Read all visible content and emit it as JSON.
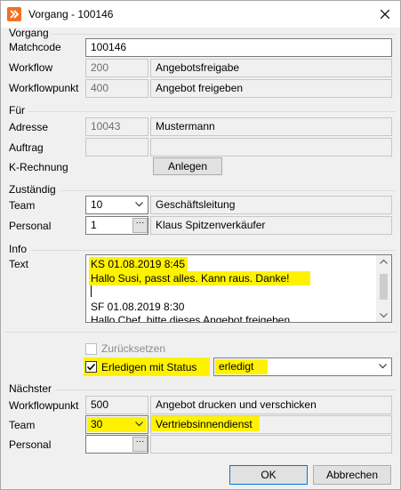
{
  "window": {
    "title": "Vorgang - 100146",
    "icon": "app-icon",
    "close_icon": "close-icon"
  },
  "vorgang": {
    "group_label": "Vorgang",
    "matchcode": {
      "label": "Matchcode",
      "value": "100146"
    },
    "workflow": {
      "label": "Workflow",
      "code": "200",
      "name": "Angebotsfreigabe"
    },
    "workflowpunkt": {
      "label": "Workflowpunkt",
      "code": "400",
      "name": "Angebot freigeben"
    }
  },
  "fuer": {
    "group_label": "Für",
    "adresse": {
      "label": "Adresse",
      "code": "10043",
      "name": "Mustermann"
    },
    "auftrag": {
      "label": "Auftrag",
      "code": "",
      "name": ""
    },
    "k_rechnung": {
      "label": "K-Rechnung",
      "button": "Anlegen"
    }
  },
  "zustaendig": {
    "group_label": "Zuständig",
    "team": {
      "label": "Team",
      "code": "10",
      "name": "Geschäftsleitung"
    },
    "personal": {
      "label": "Personal",
      "code": "1",
      "button": "···",
      "name": "Klaus Spitzenverkäufer"
    }
  },
  "info": {
    "group_label": "Info",
    "text_label": "Text",
    "lines": [
      "KS 01.08.2019 8:45",
      "Hallo Susi, passt alles. Kann raus. Danke!",
      "",
      "SF 01.08.2019 8:30",
      "Hallo Chef, bitte dieses Angebot freigeben."
    ]
  },
  "status": {
    "reset_label": "Zurücksetzen",
    "reset_checked": false,
    "complete_label": "Erledigen mit Status",
    "complete_checked": true,
    "status_value": "erledigt"
  },
  "naechster": {
    "group_label": "Nächster",
    "workflowpunkt": {
      "label": "Workflowpunkt",
      "code": "500",
      "name": "Angebot drucken und verschicken"
    },
    "team": {
      "label": "Team",
      "code": "30",
      "name": "Vertriebsinnendienst"
    },
    "personal": {
      "label": "Personal",
      "code": "",
      "button": "···",
      "name": ""
    }
  },
  "footer": {
    "ok": "OK",
    "cancel": "Abbrechen"
  },
  "colors": {
    "highlight": "#fff200",
    "accent": "#f37021"
  }
}
